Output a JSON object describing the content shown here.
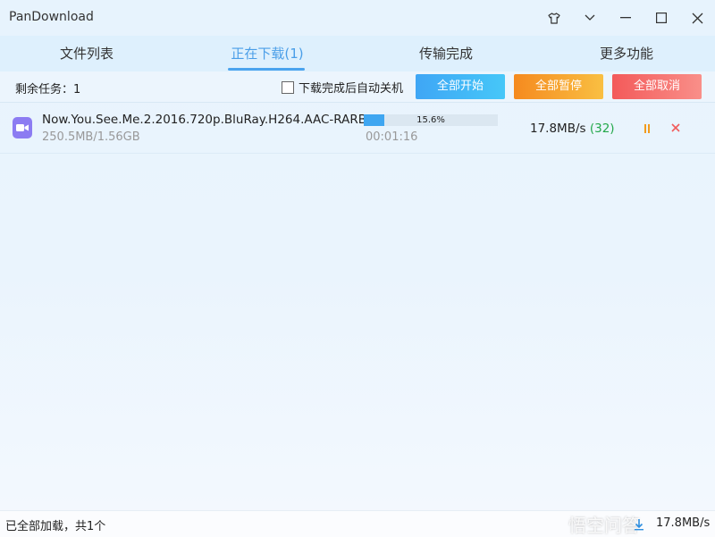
{
  "window": {
    "title": "PanDownload"
  },
  "titlebar_icons": [
    "shirt-icon",
    "chevron-down-icon",
    "minimize-icon",
    "maximize-icon",
    "close-icon"
  ],
  "tabs": [
    {
      "label": "文件列表",
      "active": false
    },
    {
      "label": "正在下载(1)",
      "active": true
    },
    {
      "label": "传输完成",
      "active": false
    },
    {
      "label": "更多功能",
      "active": false
    }
  ],
  "toolbar": {
    "remaining_tasks": "剩余任务：1",
    "auto_shutdown_label": "下载完成后自动关机",
    "auto_shutdown_checked": false,
    "start_all": "全部开始",
    "pause_all": "全部暂停",
    "cancel_all": "全部取消"
  },
  "downloads": [
    {
      "icon": "video-file-icon",
      "name": "Now.You.See.Me.2.2016.720p.BluRay.H264.AAC-RARB...",
      "size": "250.5MB/1.56GB",
      "progress": 0.156,
      "progress_text": "15.6%",
      "elapsed": "00:01:16",
      "speed": "17.8MB/s",
      "connections": "(32)"
    }
  ],
  "statusbar": {
    "text": "已全部加载，共1个",
    "watermark": "悟空问答",
    "total_speed": "17.8MB/s"
  },
  "colors": {
    "accent": "#4a9ee8",
    "start_button": "#3fa6f5",
    "pause_button": "#f7a630",
    "cancel_button": "#f47272",
    "progress": "#3fa6f1",
    "connections": "#23a84a"
  }
}
